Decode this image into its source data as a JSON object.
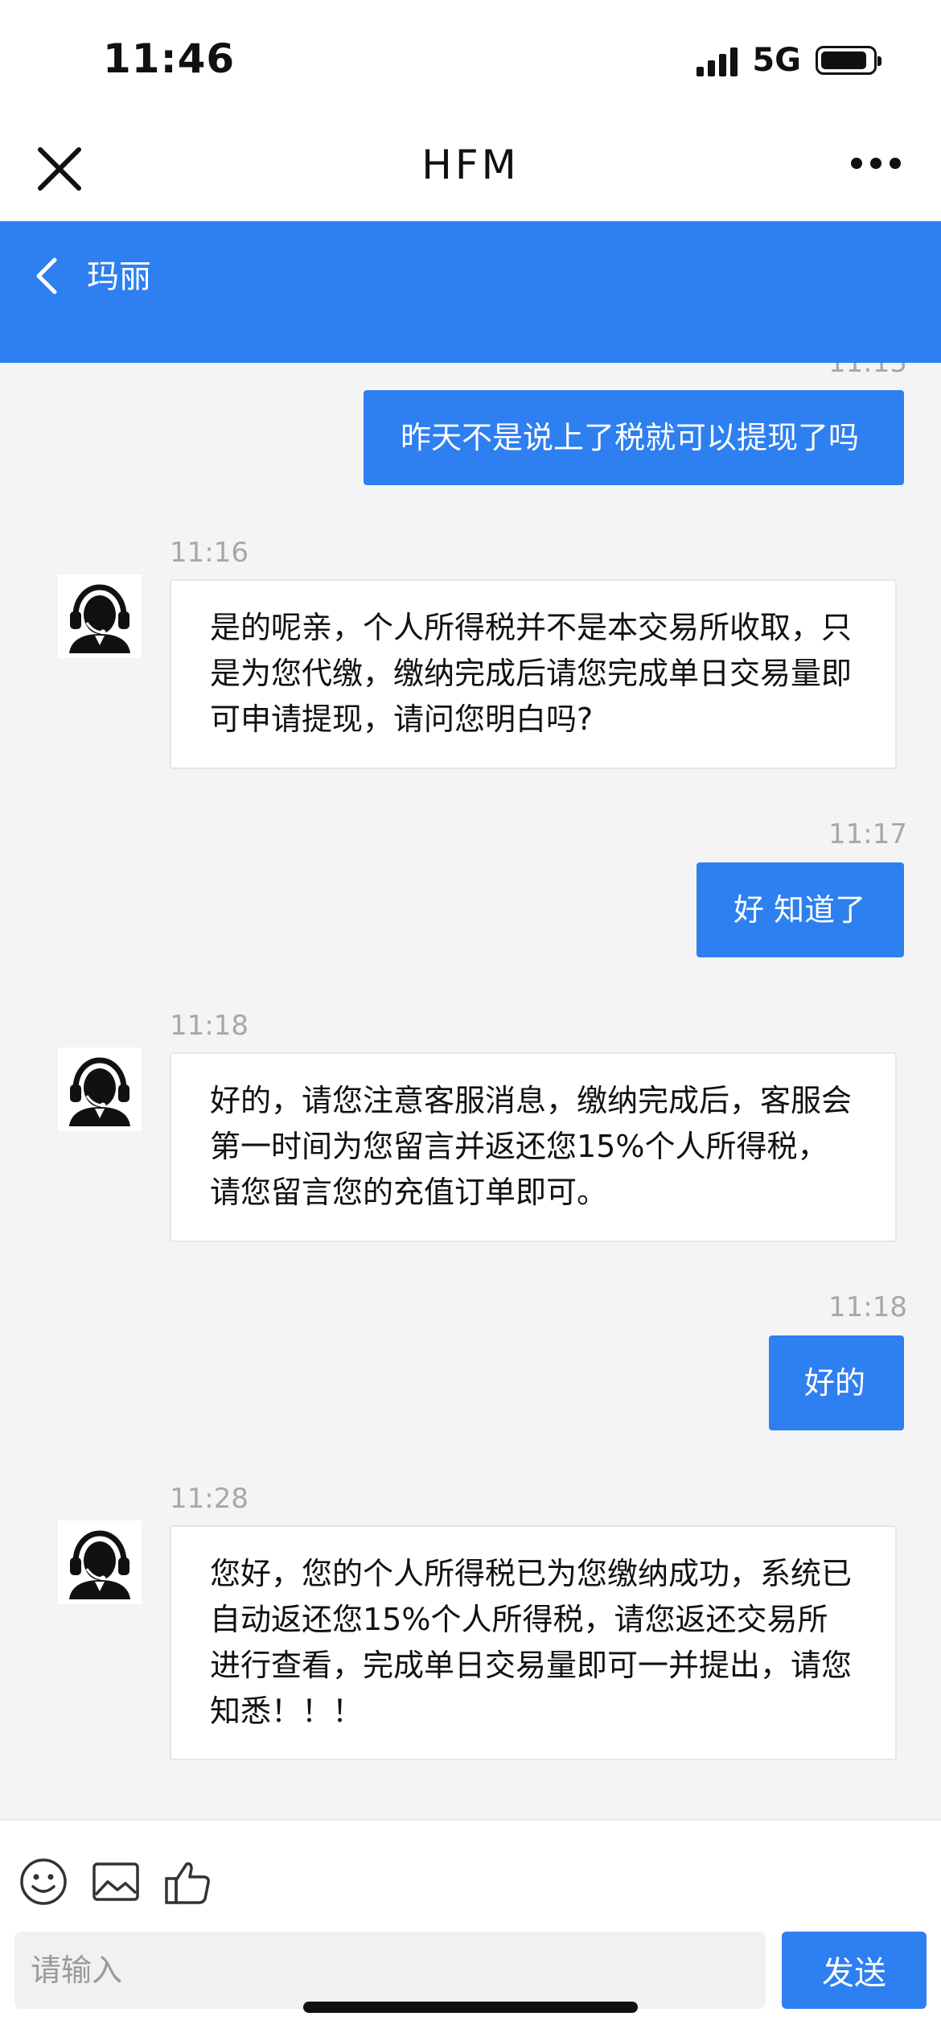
{
  "status_bar": {
    "time": "11:46",
    "network": "5G"
  },
  "top_nav": {
    "title": "HFM"
  },
  "chat_header": {
    "contact_name": "玛丽"
  },
  "messages": {
    "top_partial_time": "11:15",
    "m1": {
      "direction": "out",
      "text": "昨天不是说上了税就可以提现了吗"
    },
    "m2": {
      "direction": "in",
      "time": "11:16",
      "text": "是的呢亲，个人所得税并不是本交易所收取，只是为您代缴，缴纳完成后请您完成单日交易量即可申请提现，请问您明白吗?"
    },
    "m3": {
      "direction": "out",
      "time": "11:17",
      "text": "好 知道了"
    },
    "m4": {
      "direction": "in",
      "time": "11:18",
      "text": "好的，请您注意客服消息，缴纳完成后，客服会第一时间为您留言并返还您15%个人所得税，请您留言您的充值订单即可。"
    },
    "m5": {
      "direction": "out",
      "time": "11:18",
      "text": "好的"
    },
    "m6": {
      "direction": "in",
      "time": "11:28",
      "text": "您好，您的个人所得税已为您缴纳成功，系统已自动返还您15%个人所得税，请您返还交易所进行查看，完成单日交易量即可一并提出，请您知悉！！！"
    }
  },
  "bottom_bar": {
    "input_placeholder": "请输入",
    "send_label": "发送",
    "icons": [
      "emoji-icon",
      "image-icon",
      "thumbs-up-icon"
    ]
  },
  "colors": {
    "accent": "#2e7ff0",
    "background": "#f4f4f6"
  }
}
